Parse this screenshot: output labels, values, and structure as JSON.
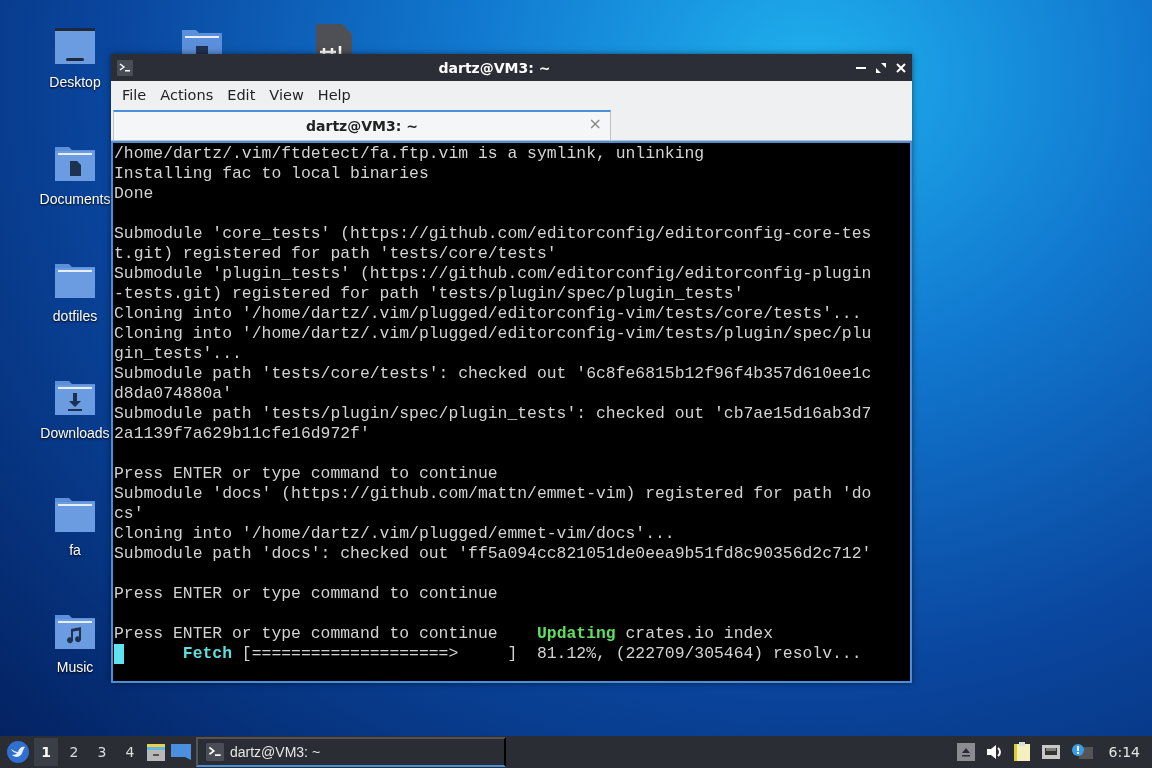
{
  "desktop_icons": [
    {
      "label": "Desktop",
      "kind": "desktop"
    },
    {
      "label": "Documents",
      "kind": "documents"
    },
    {
      "label": "dotfiles",
      "kind": "folder"
    },
    {
      "label": "Downloads",
      "kind": "downloads"
    },
    {
      "label": "fa",
      "kind": "folder"
    },
    {
      "label": "Music",
      "kind": "music"
    }
  ],
  "hidden_icons": [
    {
      "kind": "pictures"
    },
    {
      "kind": "script"
    }
  ],
  "window": {
    "title": "dartz@VM3: ~",
    "menu": [
      "File",
      "Actions",
      "Edit",
      "View",
      "Help"
    ],
    "tabs": [
      {
        "label": "dartz@VM3: ~",
        "selected": true,
        "close": "×"
      }
    ],
    "lines": [
      {
        "kind": "text",
        "segments": [
          {
            "text": "/home/dartz/.vim/ftdetect/fa.ftp.vim is a symlink, unlinking",
            "kind": "plain"
          }
        ]
      },
      {
        "kind": "text",
        "segments": [
          {
            "text": "Installing fac to local binaries",
            "kind": "plain"
          }
        ]
      },
      {
        "kind": "text",
        "segments": [
          {
            "text": "Done",
            "kind": "plain"
          }
        ]
      },
      {
        "kind": "blank"
      },
      {
        "kind": "text",
        "segments": [
          {
            "text": "Submodule 'core_tests' (https://github.com/editorconfig/editorconfig-core-tes",
            "kind": "plain"
          }
        ]
      },
      {
        "kind": "text",
        "segments": [
          {
            "text": "t.git) registered for path 'tests/core/tests'",
            "kind": "plain"
          }
        ]
      },
      {
        "kind": "text",
        "segments": [
          {
            "text": "Submodule 'plugin_tests' (https://github.com/editorconfig/editorconfig-plugin",
            "kind": "plain"
          }
        ]
      },
      {
        "kind": "text",
        "segments": [
          {
            "text": "-tests.git) registered for path 'tests/plugin/spec/plugin_tests'",
            "kind": "plain"
          }
        ]
      },
      {
        "kind": "text",
        "segments": [
          {
            "text": "Cloning into '/home/dartz/.vim/plugged/editorconfig-vim/tests/core/tests'...",
            "kind": "plain"
          }
        ]
      },
      {
        "kind": "text",
        "segments": [
          {
            "text": "Cloning into '/home/dartz/.vim/plugged/editorconfig-vim/tests/plugin/spec/plu",
            "kind": "plain"
          }
        ]
      },
      {
        "kind": "text",
        "segments": [
          {
            "text": "gin_tests'...",
            "kind": "plain"
          }
        ]
      },
      {
        "kind": "text",
        "segments": [
          {
            "text": "Submodule path 'tests/core/tests': checked out '6c8fe6815b12f96f4b357d610ee1c",
            "kind": "plain"
          }
        ]
      },
      {
        "kind": "text",
        "segments": [
          {
            "text": "d8da074880a'",
            "kind": "plain"
          }
        ]
      },
      {
        "kind": "text",
        "segments": [
          {
            "text": "Submodule path 'tests/plugin/spec/plugin_tests': checked out 'cb7ae15d16ab3d7",
            "kind": "plain"
          }
        ]
      },
      {
        "kind": "text",
        "segments": [
          {
            "text": "2a1139f7a629b11cfe16d972f'",
            "kind": "plain"
          }
        ]
      },
      {
        "kind": "blank"
      },
      {
        "kind": "text",
        "segments": [
          {
            "text": "Press ENTER or type command to continue",
            "kind": "plain"
          }
        ]
      },
      {
        "kind": "text",
        "segments": [
          {
            "text": "Submodule 'docs' (https://github.com/mattn/emmet-vim) registered for path 'do",
            "kind": "plain"
          }
        ]
      },
      {
        "kind": "text",
        "segments": [
          {
            "text": "cs'",
            "kind": "plain"
          }
        ]
      },
      {
        "kind": "text",
        "segments": [
          {
            "text": "Cloning into '/home/dartz/.vim/plugged/emmet-vim/docs'...",
            "kind": "plain"
          }
        ]
      },
      {
        "kind": "text",
        "segments": [
          {
            "text": "Submodule path 'docs': checked out 'ff5a094cc821051de0eea9b51fd8c90356d2c712'",
            "kind": "plain"
          }
        ]
      },
      {
        "kind": "blank"
      },
      {
        "kind": "text",
        "segments": [
          {
            "text": "Press ENTER or type command to continue",
            "kind": "plain"
          }
        ]
      },
      {
        "kind": "blank"
      },
      {
        "kind": "text",
        "segments": [
          {
            "text": "Press ENTER or type command to continue    ",
            "kind": "plain"
          },
          {
            "text": "Updating",
            "kind": "status"
          },
          {
            "text": " crates.io index",
            "kind": "plain"
          }
        ]
      },
      {
        "kind": "cursor",
        "segments": [
          {
            "text": "Fetch",
            "kind": "step"
          },
          {
            "text": " [====================>     ]  81.12%, (222709/305464) resolv...",
            "kind": "plain"
          }
        ]
      }
    ]
  },
  "taskbar": {
    "workspaces": [
      {
        "label": "1",
        "selected": true
      },
      {
        "label": "2",
        "selected": false
      },
      {
        "label": "3",
        "selected": false
      },
      {
        "label": "4",
        "selected": false
      }
    ],
    "tasks": [
      {
        "label": "dartz@VM3: ~",
        "selected": true
      }
    ],
    "clock": "6:14"
  }
}
